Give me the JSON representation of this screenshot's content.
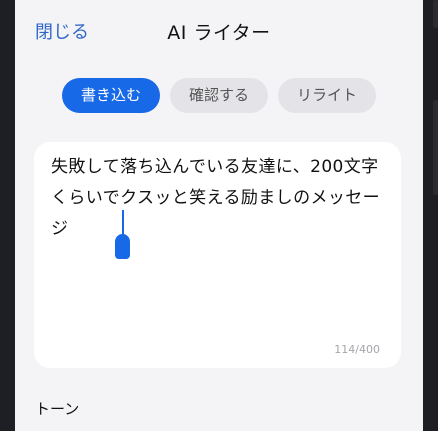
{
  "header": {
    "close_label": "閉じる",
    "title": "AI ライター"
  },
  "tabs": [
    {
      "label": "書き込む",
      "active": true
    },
    {
      "label": "確認する",
      "active": false
    },
    {
      "label": "リライト",
      "active": false
    }
  ],
  "editor": {
    "text": "失敗して落ち込んでいる友達に、200文字くらいでクスッと笑える励ましのメッセージ",
    "char_count": "114/400"
  },
  "options": {
    "tone_label": "トーン"
  },
  "colors": {
    "accent": "#1769e8",
    "link": "#2f66c8",
    "background": "#f4f4f6"
  }
}
